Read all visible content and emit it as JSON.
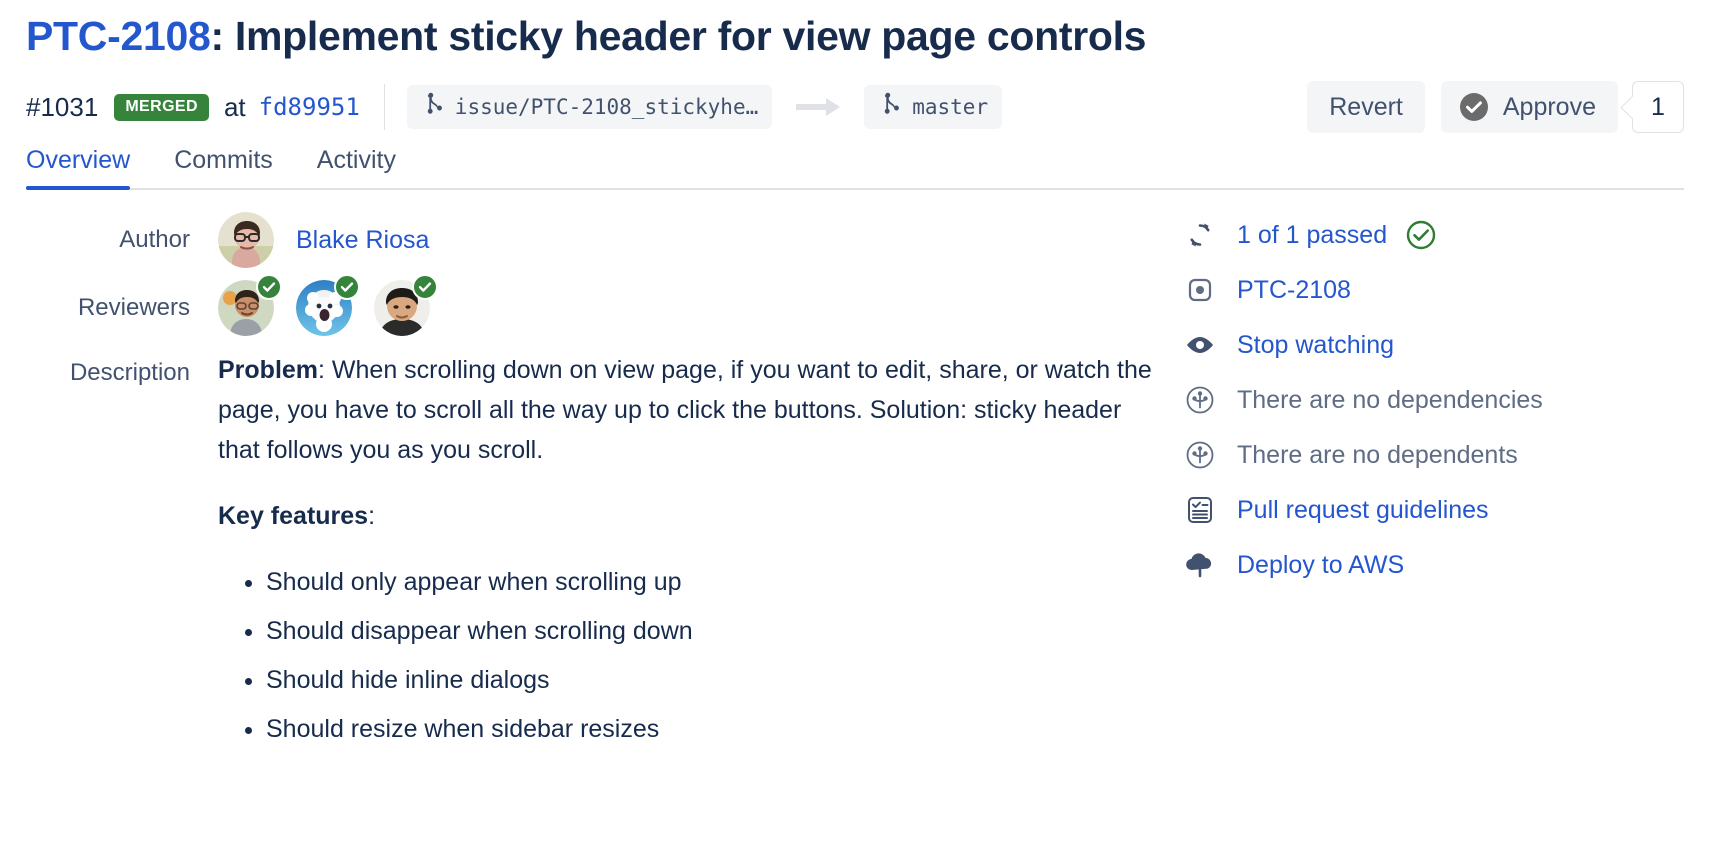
{
  "header": {
    "issue_key": "PTC-2108",
    "title_separator": ": ",
    "title": "Implement sticky header for view page controls"
  },
  "status": {
    "pr_number": "#1031",
    "merge_state": "MERGED",
    "at_label": "at",
    "commit_hash": "fd89951",
    "source_branch": "issue/PTC‑2108_stickyhe…",
    "target_branch": "master",
    "arrow_icon": "arrow-right-icon",
    "branch_icon": "branch-icon",
    "merged_color": "#36843B",
    "link_color": "#2456CE"
  },
  "actions": {
    "revert_label": "Revert",
    "approve_label": "Approve",
    "approve_icon": "check-circle-icon",
    "approve_count": "1"
  },
  "tabs": [
    {
      "label": "Overview",
      "active": true
    },
    {
      "label": "Commits",
      "active": false
    },
    {
      "label": "Activity",
      "active": false
    }
  ],
  "details": {
    "author_label": "Author",
    "author_name": "Blake Riosa",
    "reviewers_label": "Reviewers",
    "reviewers": [
      {
        "name": "reviewer-1",
        "approved": true
      },
      {
        "name": "reviewer-2",
        "approved": true
      },
      {
        "name": "reviewer-3",
        "approved": true
      }
    ],
    "description_label": "Description",
    "problem_lead": "Problem",
    "problem_text": ": When scrolling down on view page, if you want to edit, share, or watch the page, you have to scroll all the way up to click the buttons. Solution: sticky header that follows you as you scroll.",
    "key_features_lead": "Key features",
    "key_features_colon": ":",
    "key_features": [
      "Should only appear when scrolling up",
      "Should disappear when scrolling down",
      "Should hide inline dialogs",
      "Should resize when sidebar resizes"
    ]
  },
  "sidebar": [
    {
      "icon": "builds-refresh-icon",
      "label": "1 of 1 passed",
      "muted": false,
      "trailing_icon": "check-circle-outline-icon"
    },
    {
      "icon": "jira-issue-icon",
      "label": "PTC-2108",
      "muted": false,
      "trailing_icon": ""
    },
    {
      "icon": "eye-icon",
      "label": "Stop watching",
      "muted": false,
      "trailing_icon": ""
    },
    {
      "icon": "dependency-icon",
      "label": "There are no dependencies",
      "muted": true,
      "trailing_icon": ""
    },
    {
      "icon": "dependency-icon",
      "label": "There are no dependents",
      "muted": true,
      "trailing_icon": ""
    },
    {
      "icon": "guidelines-icon",
      "label": "Pull request guidelines",
      "muted": false,
      "trailing_icon": ""
    },
    {
      "icon": "cloud-upload-icon",
      "label": "Deploy to AWS",
      "muted": false,
      "trailing_icon": ""
    }
  ]
}
